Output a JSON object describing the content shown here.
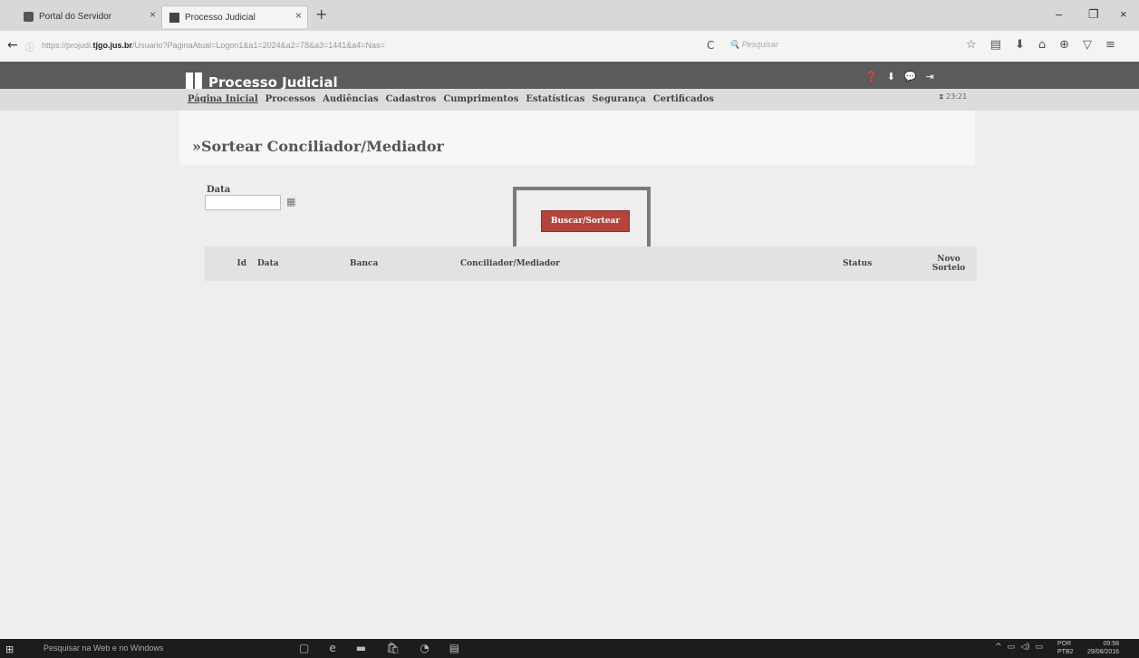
{
  "browser": {
    "tabs": [
      {
        "label": "Portal do Servidor"
      },
      {
        "label": "Processo Judicial"
      }
    ],
    "tab_close": "×",
    "new_tab": "+",
    "window": {
      "minimize": "–",
      "restore": "❐",
      "close": "×"
    },
    "url": {
      "prefix": "https://projudi.",
      "domain": "tjgo.jus.br",
      "path": "/Usuario?PaginaAtual=Logon1&a1=2024&a2=78&a3=1441&a4=Nas="
    },
    "search_placeholder": "Pesquisar",
    "icons": {
      "back": "←",
      "info": "ⓘ",
      "reload": "C",
      "star": "☆",
      "reader": "▤",
      "download": "⬇",
      "home": "⌂",
      "sync": "⊕",
      "pocket": "▽",
      "menu": "≡"
    }
  },
  "app": {
    "title": "Processo Judicial",
    "header_icons": {
      "help": "❓",
      "download": "⬇",
      "chat": "💬",
      "logout": "⇥"
    },
    "clock": "⧗ 23:21",
    "menu": [
      {
        "label": "Página Inicial"
      },
      {
        "label": "Processos"
      },
      {
        "label": "Audiências"
      },
      {
        "label": "Cadastros"
      },
      {
        "label": "Cumprimentos"
      },
      {
        "label": "Estatísticas"
      },
      {
        "label": "Segurança"
      },
      {
        "label": "Certificados"
      }
    ]
  },
  "page": {
    "title": "»Sortear Conciliador/Mediador",
    "date_label": "Data",
    "date_value": "",
    "calendar_icon": "▦",
    "search_button": "Buscar/Sortear",
    "table": {
      "headers": {
        "id": "Id",
        "data": "Data",
        "banca": "Banca",
        "conciliador": "Conciliador/Mediador",
        "status": "Status",
        "novo_1": "Novo",
        "novo_2": "Sorteio"
      }
    }
  },
  "taskbar": {
    "start": "⊞",
    "search": "Pesquisar na Web e no Windows",
    "icons": {
      "task_view": "▢",
      "edge": "e",
      "explorer": "▬",
      "store": "🛍",
      "firefox": "◔",
      "files": "▤"
    },
    "tray": {
      "up": "^",
      "network": "▭",
      "volume": "◁)",
      "message": "▭"
    },
    "lang_1": "POR",
    "lang_2": "PTB2",
    "time": "09:58",
    "date": "29/08/2016"
  }
}
